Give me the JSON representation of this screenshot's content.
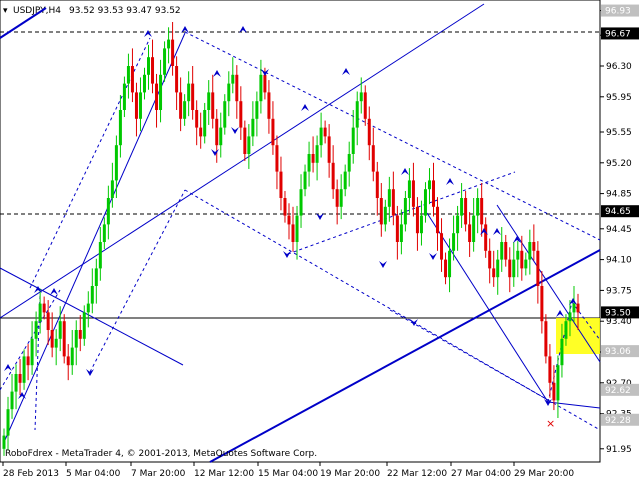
{
  "header": {
    "symbol": "USDJPY,H4",
    "ohlc": "93.52 93.53 93.47 93.52"
  },
  "watermark": "RoboFdrex - MetaTrader 4, © 2001-2013, MetaQuotes Software Corp.",
  "colors": {
    "background": "#ffffff",
    "bull_candle": "#00c800",
    "bear_candle": "#e00000",
    "trendline": "#0000c8",
    "grid_dash": "#000000",
    "price_marker_bg": "#000000",
    "target_zone": "#ffff00"
  },
  "price_markers": [
    {
      "value": "96.93",
      "style": "grey"
    },
    {
      "value": "96.67",
      "style": "black"
    },
    {
      "value": "94.65",
      "style": "black"
    },
    {
      "value": "93.50",
      "style": "black"
    },
    {
      "value": "93.06",
      "style": "grey"
    },
    {
      "value": "92.62",
      "style": "grey"
    },
    {
      "value": "92.28",
      "style": "grey"
    }
  ],
  "chart_data": {
    "type": "candlestick",
    "title": "USDJPY,H4",
    "y_ticks": [
      "96.93",
      "96.65",
      "96.30",
      "95.95",
      "95.55",
      "95.20",
      "94.85",
      "94.45",
      "94.10",
      "93.75",
      "93.40",
      "93.05",
      "92.70",
      "92.35",
      "91.95"
    ],
    "ylim": [
      91.8,
      97.05
    ],
    "x_ticks": [
      "28 Feb 2013",
      "5 Mar 04:00",
      "7 Mar 20:00",
      "12 Mar 12:00",
      "15 Mar 04:00",
      "19 Mar 20:00",
      "22 Mar 12:00",
      "27 Mar 04:00",
      "29 Mar 20:00"
    ],
    "close_series": [
      92.1,
      92.4,
      92.6,
      92.8,
      92.7,
      93.0,
      92.9,
      93.2,
      93.4,
      93.6,
      93.5,
      93.3,
      93.1,
      93.2,
      93.4,
      93.0,
      92.9,
      93.1,
      93.3,
      93.2,
      93.5,
      93.6,
      93.8,
      94.0,
      94.3,
      94.5,
      94.8,
      95.0,
      95.4,
      95.8,
      96.1,
      96.3,
      96.0,
      95.7,
      96.0,
      96.2,
      96.4,
      96.1,
      95.8,
      96.2,
      96.5,
      96.6,
      96.3,
      96.0,
      95.7,
      95.9,
      96.1,
      95.8,
      95.6,
      95.5,
      95.8,
      96.0,
      95.7,
      95.4,
      95.6,
      95.9,
      96.1,
      96.2,
      95.9,
      95.6,
      95.3,
      95.5,
      95.7,
      95.9,
      96.2,
      96.0,
      95.7,
      95.4,
      95.1,
      94.8,
      94.6,
      94.5,
      94.3,
      94.6,
      94.9,
      95.1,
      95.3,
      95.2,
      95.4,
      95.6,
      95.5,
      95.2,
      94.9,
      94.7,
      94.9,
      95.1,
      95.3,
      95.6,
      95.9,
      96.0,
      95.7,
      95.4,
      95.1,
      94.8,
      94.5,
      94.7,
      94.9,
      94.6,
      94.3,
      94.5,
      94.8,
      95.0,
      94.7,
      94.4,
      94.6,
      94.9,
      95.0,
      94.7,
      94.4,
      94.1,
      93.9,
      94.2,
      94.4,
      94.6,
      94.8,
      94.5,
      94.3,
      94.6,
      94.8,
      94.5,
      94.2,
      94.0,
      93.9,
      94.1,
      94.3,
      94.1,
      93.9,
      94.1,
      94.2,
      94.0,
      94.1,
      94.3,
      94.2,
      93.8,
      93.4,
      93.0,
      92.7,
      92.5,
      92.9,
      93.2,
      93.4,
      93.5,
      93.6,
      93.5
    ],
    "target_zone": {
      "from": 93.06,
      "to": 93.5
    }
  }
}
